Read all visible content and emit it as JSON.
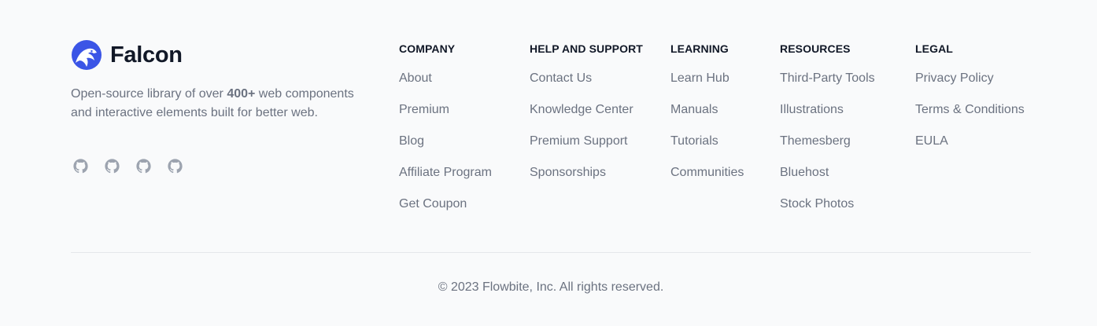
{
  "brand": {
    "name": "Falcon",
    "logo_color": "#3b55e6"
  },
  "description": {
    "before": "Open-source library of over ",
    "highlight": "400+",
    "after": " web components and interactive elements built for better web."
  },
  "socials": [
    {
      "icon": "github-icon"
    },
    {
      "icon": "github-icon"
    },
    {
      "icon": "github-icon"
    },
    {
      "icon": "github-icon"
    }
  ],
  "columns": [
    {
      "title": "COMPANY",
      "links": [
        "About",
        "Premium",
        "Blog",
        "Affiliate Program",
        "Get Coupon"
      ]
    },
    {
      "title": "HELP AND SUPPORT",
      "links": [
        "Contact Us",
        "Knowledge Center",
        "Premium Support",
        "Sponsorships"
      ]
    },
    {
      "title": "LEARNING",
      "links": [
        "Learn Hub",
        "Manuals",
        "Tutorials",
        "Communities"
      ]
    },
    {
      "title": "RESOURCES",
      "links": [
        "Third-Party Tools",
        "Illustrations",
        "Themesberg",
        "Bluehost",
        "Stock Photos"
      ]
    },
    {
      "title": "LEGAL",
      "links": [
        "Privacy Policy",
        "Terms & Conditions",
        "EULA"
      ]
    }
  ],
  "copyright": "© 2023 Flowbite, Inc. All rights reserved."
}
